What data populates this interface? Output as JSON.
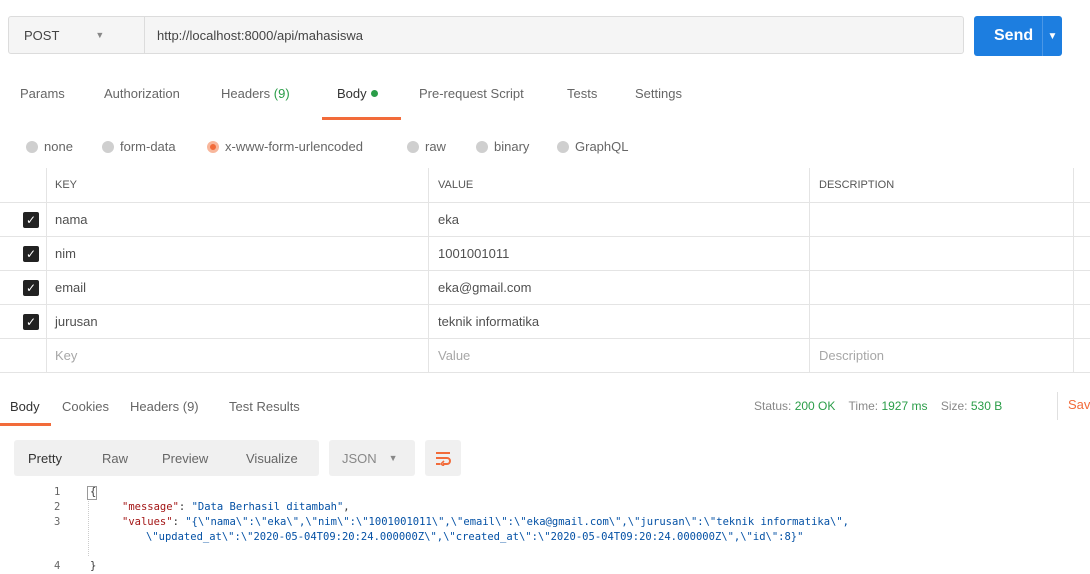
{
  "request": {
    "method": "POST",
    "url": "http://localhost:8000/api/mahasiswa",
    "send_label": "Send"
  },
  "req_tabs": {
    "params": "Params",
    "authorization": "Authorization",
    "headers": "Headers",
    "headers_count": "(9)",
    "body": "Body",
    "pre_request": "Pre-request Script",
    "tests": "Tests",
    "settings": "Settings"
  },
  "body_types": {
    "none": "none",
    "form_data": "form-data",
    "urlencoded": "x-www-form-urlencoded",
    "raw": "raw",
    "binary": "binary",
    "graphql": "GraphQL",
    "selected": "x-www-form-urlencoded"
  },
  "table": {
    "headers": {
      "key": "KEY",
      "value": "VALUE",
      "description": "DESCRIPTION"
    },
    "rows": [
      {
        "key": "nama",
        "value": "eka",
        "description": ""
      },
      {
        "key": "nim",
        "value": "1001001011",
        "description": ""
      },
      {
        "key": "email",
        "value": "eka@gmail.com",
        "description": ""
      },
      {
        "key": "jurusan",
        "value": "teknik informatika",
        "description": ""
      }
    ],
    "placeholders": {
      "key": "Key",
      "value": "Value",
      "description": "Description"
    }
  },
  "response": {
    "tabs": {
      "body": "Body",
      "cookies": "Cookies",
      "headers": "Headers (9)",
      "test_results": "Test Results"
    },
    "status_label": "Status:",
    "status_value": "200 OK",
    "time_label": "Time:",
    "time_value": "1927 ms",
    "size_label": "Size:",
    "size_value": "530 B",
    "save_label": "Sav",
    "formats": {
      "pretty": "Pretty",
      "raw": "Raw",
      "preview": "Preview",
      "visualize": "Visualize"
    },
    "lang": "JSON",
    "code": {
      "line_numbers": [
        "1",
        "2",
        "3",
        "4"
      ],
      "open_brace": "{",
      "close_brace": "}",
      "message_key": "\"message\"",
      "message_value": "\"Data Berhasil ditambah\"",
      "values_key": "\"values\"",
      "values_part1": "\"{\\\"nama\\\":\\\"eka\\\",\\\"nim\\\":\\\"1001001011\\\",\\\"email\\\":\\\"eka@gmail.com\\\",\\\"jurusan\\\":\\\"teknik informatika\\\",",
      "values_part2": "\\\"updated_at\\\":\\\"2020-05-04T09:20:24.000000Z\\\",\\\"created_at\\\":\\\"2020-05-04T09:20:24.000000Z\\\",\\\"id\\\":8}\""
    }
  },
  "colors": {
    "accent": "#f26b3a",
    "send": "#1d7ee0",
    "success": "#2a9d48"
  }
}
